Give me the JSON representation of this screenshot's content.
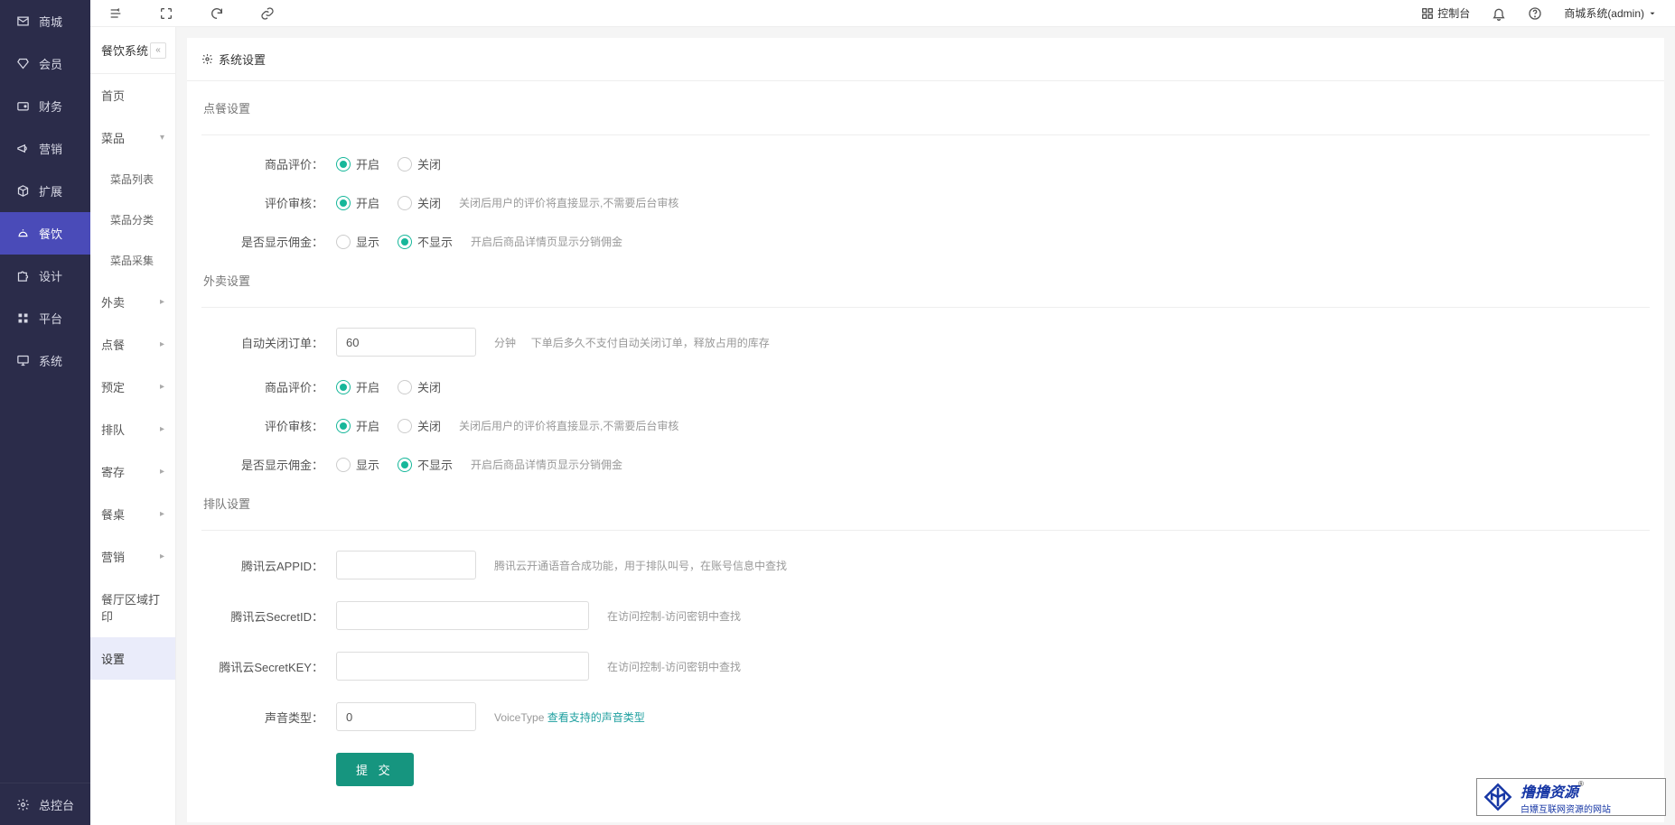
{
  "header": {
    "console": "控制台",
    "user": "商城系统(admin)"
  },
  "nav": {
    "items": [
      {
        "label": "商城"
      },
      {
        "label": "会员"
      },
      {
        "label": "财务"
      },
      {
        "label": "营销"
      },
      {
        "label": "扩展"
      },
      {
        "label": "餐饮"
      },
      {
        "label": "设计"
      },
      {
        "label": "平台"
      },
      {
        "label": "系统"
      }
    ],
    "footer": "总控台"
  },
  "subnav": {
    "title": "餐饮系统",
    "items": {
      "home": "首页",
      "products": "菜品",
      "product_list": "菜品列表",
      "product_cat": "菜品分类",
      "product_collect": "菜品采集",
      "takeout": "外卖",
      "ordering": "点餐",
      "reserve": "预定",
      "queue": "排队",
      "store": "寄存",
      "table": "餐桌",
      "marketing": "营销",
      "print": "餐厅区域打印",
      "settings": "设置"
    }
  },
  "panel": {
    "title": "系统设置"
  },
  "sections": {
    "ordering": "点餐设置",
    "takeout": "外卖设置",
    "queue": "排队设置"
  },
  "labels": {
    "product_review": "商品评价",
    "review_audit": "评价审核",
    "show_commission": "是否显示佣金",
    "auto_close": "自动关闭订单",
    "tencent_appid": "腾讯云APPID",
    "tencent_secretid": "腾讯云SecretID",
    "tencent_secretkey": "腾讯云SecretKEY",
    "voice_type": "声音类型"
  },
  "options": {
    "open": "开启",
    "close": "关闭",
    "show": "显示",
    "hide": "不显示"
  },
  "hints": {
    "audit": "关闭后用户的评价将直接显示,不需要后台审核",
    "commission": "开启后商品详情页显示分销佣金",
    "auto_close_unit": "分钟",
    "auto_close": "下单后多久不支付自动关闭订单，释放占用的库存",
    "appid": "腾讯云开通语音合成功能，用于排队叫号，在账号信息中查找",
    "secret": "在访问控制-访问密钥中查找",
    "voice_prefix": "VoiceType ",
    "voice_link": "查看支持的声音类型"
  },
  "values": {
    "auto_close": "60",
    "voice_type": "0",
    "appid": "",
    "secretid": "",
    "secretkey": ""
  },
  "buttons": {
    "submit": "提 交"
  },
  "watermark": {
    "line1": "撸撸资源",
    "reg": "®",
    "line2": "白嫖互联网资源的网站"
  }
}
